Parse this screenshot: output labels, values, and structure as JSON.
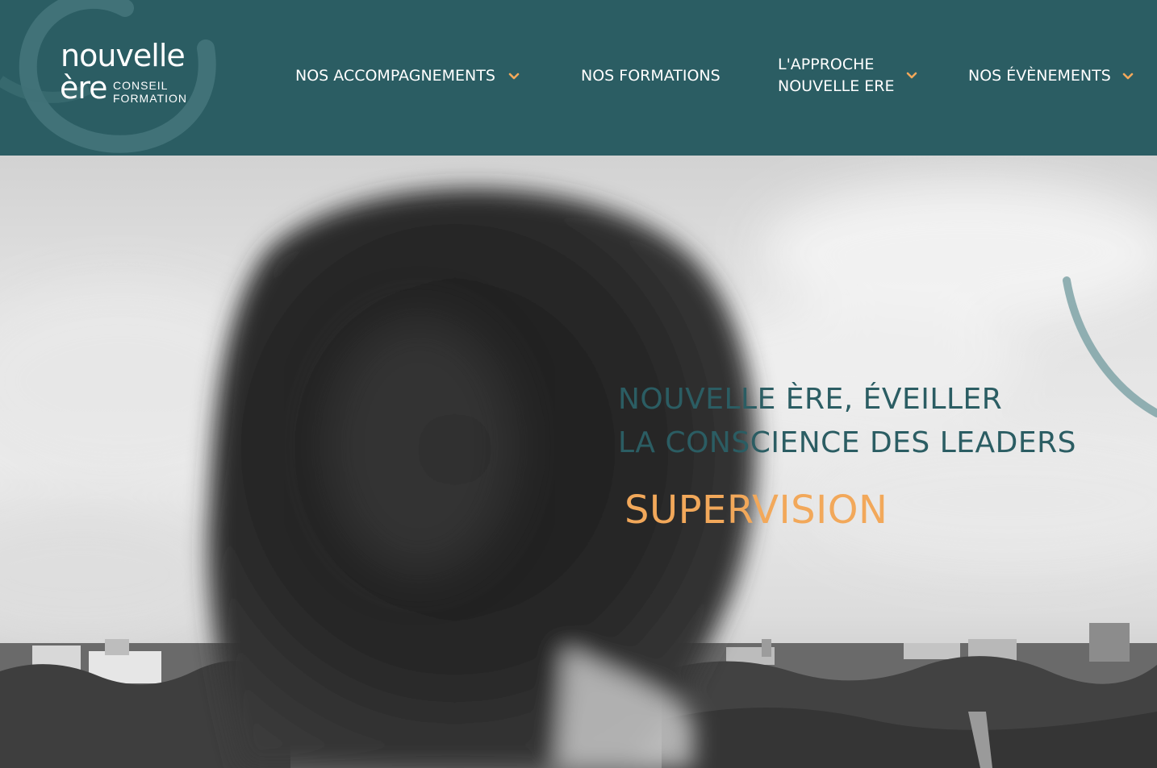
{
  "brand": {
    "name_line1": "nouvelle",
    "name_line2": "ère",
    "tagline_line1": "CONSEIL",
    "tagline_line2": "FORMATION"
  },
  "nav": {
    "items": [
      {
        "label": "NOS ACCOMPAGNEMENTS",
        "has_dropdown": true
      },
      {
        "label": "NOS FORMATIONS",
        "has_dropdown": false
      },
      {
        "label": "L'APPROCHE\nNOUVELLE ERE",
        "has_dropdown": true
      },
      {
        "label": "NOS ÉVÈNEMENTS",
        "has_dropdown": true
      }
    ]
  },
  "hero": {
    "headline_line1": "NOUVELLE ÈRE, ÉVEILLER",
    "headline_line2": "LA CONSCIENCE DES LEADERS",
    "subheadline": "SUPERVISION"
  },
  "colors": {
    "header_bg": "#2b5d63",
    "accent_orange": "#f2a85a",
    "headline_teal": "#2b5d63"
  },
  "icons": {
    "dropdown": "chevron-down-icon"
  }
}
